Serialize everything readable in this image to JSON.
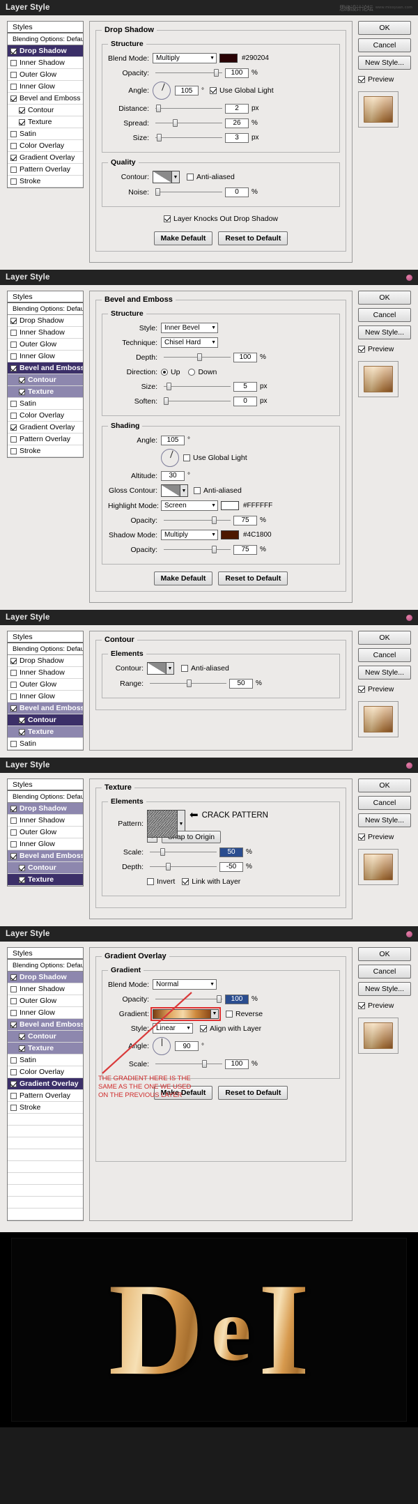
{
  "window": {
    "title": "Layer Style",
    "watermark": "www.missyuan.com",
    "watermark_cn": "思缘设计论坛"
  },
  "sidebar": {
    "header": "Styles",
    "blending": "Blending Options: Default",
    "items": [
      {
        "label": "Drop Shadow",
        "checked": true
      },
      {
        "label": "Inner Shadow",
        "checked": false
      },
      {
        "label": "Outer Glow",
        "checked": false
      },
      {
        "label": "Inner Glow",
        "checked": false
      },
      {
        "label": "Bevel and Emboss",
        "checked": true
      },
      {
        "label": "Contour",
        "checked": true,
        "indent": true
      },
      {
        "label": "Texture",
        "checked": true,
        "indent": true
      },
      {
        "label": "Satin",
        "checked": false
      },
      {
        "label": "Color Overlay",
        "checked": false
      },
      {
        "label": "Gradient Overlay",
        "checked": true
      },
      {
        "label": "Pattern Overlay",
        "checked": false
      },
      {
        "label": "Stroke",
        "checked": false
      }
    ]
  },
  "buttons": {
    "ok": "OK",
    "cancel": "Cancel",
    "new_style": "New Style...",
    "preview": "Preview",
    "make_default": "Make Default",
    "reset_default": "Reset to Default"
  },
  "panel1": {
    "legend": "Drop Shadow",
    "structure_legend": "Structure",
    "quality_legend": "Quality",
    "blend_mode_label": "Blend Mode:",
    "blend_mode_value": "Multiply",
    "color_hex": "#290204",
    "opacity_label": "Opacity:",
    "opacity_value": "100",
    "opacity_unit": "%",
    "angle_label": "Angle:",
    "angle_value": "105",
    "angle_unit": "°",
    "global_light": "Use Global Light",
    "distance_label": "Distance:",
    "distance_value": "2",
    "distance_unit": "px",
    "spread_label": "Spread:",
    "spread_value": "26",
    "spread_unit": "%",
    "size_label": "Size:",
    "size_value": "3",
    "size_unit": "px",
    "contour_label": "Contour:",
    "anti_aliased": "Anti-aliased",
    "noise_label": "Noise:",
    "noise_value": "0",
    "noise_unit": "%",
    "knockout": "Layer Knocks Out Drop Shadow"
  },
  "panel2": {
    "legend": "Bevel and Emboss",
    "structure_legend": "Structure",
    "shading_legend": "Shading",
    "style_label": "Style:",
    "style_value": "Inner Bevel",
    "technique_label": "Technique:",
    "technique_value": "Chisel Hard",
    "depth_label": "Depth:",
    "depth_value": "100",
    "depth_unit": "%",
    "direction_label": "Direction:",
    "direction_up": "Up",
    "direction_down": "Down",
    "size_label": "Size:",
    "size_value": "5",
    "size_unit": "px",
    "soften_label": "Soften:",
    "soften_value": "0",
    "soften_unit": "px",
    "angle_label": "Angle:",
    "angle_value": "105",
    "angle_unit": "°",
    "global_light": "Use Global Light",
    "altitude_label": "Altitude:",
    "altitude_value": "30",
    "altitude_unit": "°",
    "gloss_label": "Gloss Contour:",
    "anti_aliased": "Anti-aliased",
    "highlight_label": "Highlight Mode:",
    "highlight_value": "Screen",
    "highlight_hex": "#FFFFFF",
    "highlight_opacity_label": "Opacity:",
    "highlight_opacity_value": "75",
    "shadow_label": "Shadow Mode:",
    "shadow_value": "Multiply",
    "shadow_hex": "#4C1800",
    "shadow_opacity_label": "Opacity:",
    "shadow_opacity_value": "75",
    "pct": "%"
  },
  "panel3": {
    "legend": "Contour",
    "elements_legend": "Elements",
    "contour_label": "Contour:",
    "anti_aliased": "Anti-aliased",
    "range_label": "Range:",
    "range_value": "50",
    "range_unit": "%"
  },
  "panel4": {
    "legend": "Texture",
    "elements_legend": "Elements",
    "pattern_label": "Pattern:",
    "snap_label": "Snap to Origin",
    "note": "CRACK PATTERN",
    "scale_label": "Scale:",
    "scale_value": "50",
    "scale_unit": "%",
    "depth_label": "Depth:",
    "depth_value": "-50",
    "depth_unit": "%",
    "invert_label": "Invert",
    "link_label": "Link with Layer"
  },
  "panel5": {
    "legend": "Gradient Overlay",
    "gradient_legend": "Gradient",
    "blend_mode_label": "Blend Mode:",
    "blend_mode_value": "Normal",
    "opacity_label": "Opacity:",
    "opacity_value": "100",
    "opacity_unit": "%",
    "gradient_label": "Gradient:",
    "reverse_label": "Reverse",
    "style_label": "Style:",
    "style_value": "Linear",
    "align_label": "Align with Layer",
    "angle_label": "Angle:",
    "angle_value": "90",
    "angle_unit": "°",
    "scale_label": "Scale:",
    "scale_value": "100",
    "scale_unit": "%",
    "annotation": "THE GRADIENT HERE IS THE\nSAME AS THE ONE WE USED\nON THE PREVIOUS LAYER"
  },
  "artwork": {
    "letters": [
      "D",
      "e",
      "I"
    ]
  },
  "colors": {
    "selection": "#3b2f68",
    "selection_light": "#8d87ae",
    "titlebar": "#232323",
    "panel_bg": "#eceae8",
    "annotation": "#cf2a2a"
  }
}
